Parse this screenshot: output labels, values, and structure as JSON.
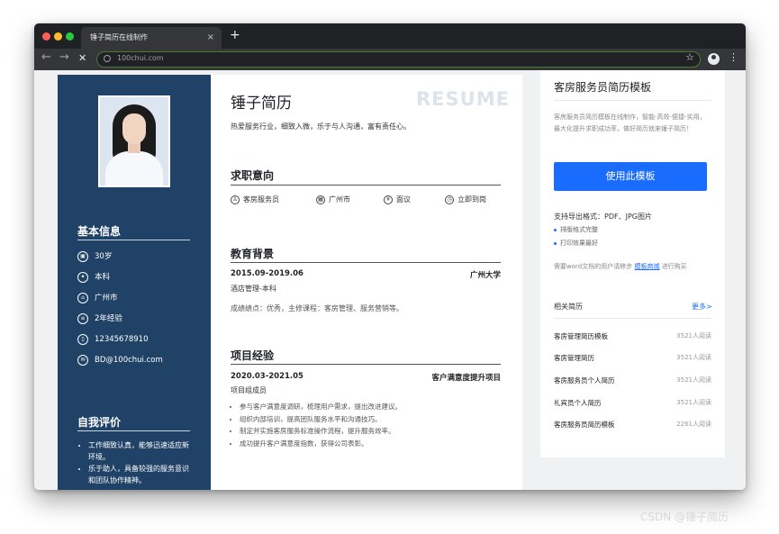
{
  "browser": {
    "tab_title": "锤子简历在线制作",
    "tab_close": "×",
    "new_tab": "+",
    "url": "100chui.com",
    "star": "☆",
    "menu": "⋮",
    "back": "←",
    "forward": "→",
    "stop": "✕"
  },
  "resume": {
    "name": "锤子简历",
    "resume_word": "RESUME",
    "tagline": "热爱服务行业，细致入微，乐于与人沟通，富有责任心。",
    "basic_info_title": "基本信息",
    "basic_info": [
      {
        "icon": "age-icon",
        "glyph": "▣",
        "text": "30岁"
      },
      {
        "icon": "education-icon",
        "glyph": "✦",
        "text": "本科"
      },
      {
        "icon": "location-icon",
        "glyph": "⌂",
        "text": "广州市"
      },
      {
        "icon": "experience-icon",
        "glyph": "≡",
        "text": "2年经验"
      },
      {
        "icon": "phone-icon",
        "glyph": "▯",
        "text": "12345678910"
      },
      {
        "icon": "email-icon",
        "glyph": "✉",
        "text": "BD@100chui.com"
      }
    ],
    "self_eval_title": "自我评价",
    "self_eval": [
      "工作细致认真，能够迅速适应新环境。",
      "乐于助人，具备较强的服务意识和团队协作精神。"
    ],
    "intent_title": "求职意向",
    "intent": [
      {
        "icon": "medal-icon",
        "glyph": "♙",
        "text": "客房服务员"
      },
      {
        "icon": "building-icon",
        "glyph": "▦",
        "text": "广州市"
      },
      {
        "icon": "salary-icon",
        "glyph": "¥",
        "text": "面议"
      },
      {
        "icon": "clock-icon",
        "glyph": "◷",
        "text": "立即到岗"
      }
    ],
    "education_title": "教育背景",
    "education": {
      "period": "2015.09-2019.06",
      "school": "广州大学",
      "major": "酒店管理-本科",
      "detail": "成绩绩点：优秀，主修课程：客房管理、服务营销等。"
    },
    "project_title": "项目经验",
    "project": {
      "period": "2020.03-2021.05",
      "name": "客户满意度提升项目",
      "role": "项目组成员",
      "bullets": [
        "参与客户满意度调研，梳理用户需求，提出改进建议。",
        "组织内部培训，提高团队服务水平和沟通技巧。",
        "制定并实施客房服务标准操作流程，提升服务效率。",
        "成功提升客户满意度指数，获得公司表彰。"
      ]
    }
  },
  "panel": {
    "title": "客房服务员简历模板",
    "description": "客房服务员简历模板在线制作，智能-高效-便捷-实用，最大化提升求职成功率，做好简历就来锤子简历！",
    "use_button": "使用此模板",
    "support": "支持导出格式：PDF、JPG图片",
    "features": [
      "排版格式完整",
      "打印效果最好"
    ],
    "note_prefix": "需要word文档的用户请移步",
    "note_link": "模板商城",
    "note_suffix": "进行购买",
    "related_title": "相关简历",
    "more": "更多>",
    "related": [
      {
        "name": "客房管理简历模板",
        "count": "3521人阅读"
      },
      {
        "name": "客房管理简历",
        "count": "3521人阅读"
      },
      {
        "name": "客房服务员个人简历",
        "count": "3521人阅读"
      },
      {
        "name": "礼宾员个人简历",
        "count": "3521人阅读"
      },
      {
        "name": "客房服务员简历模板",
        "count": "2261人阅读"
      }
    ]
  },
  "watermark": "CSDN @锤子简历",
  "colors": {
    "sidebar": "#1f4266",
    "accent": "#1a6cff",
    "chrome": "#202124"
  }
}
